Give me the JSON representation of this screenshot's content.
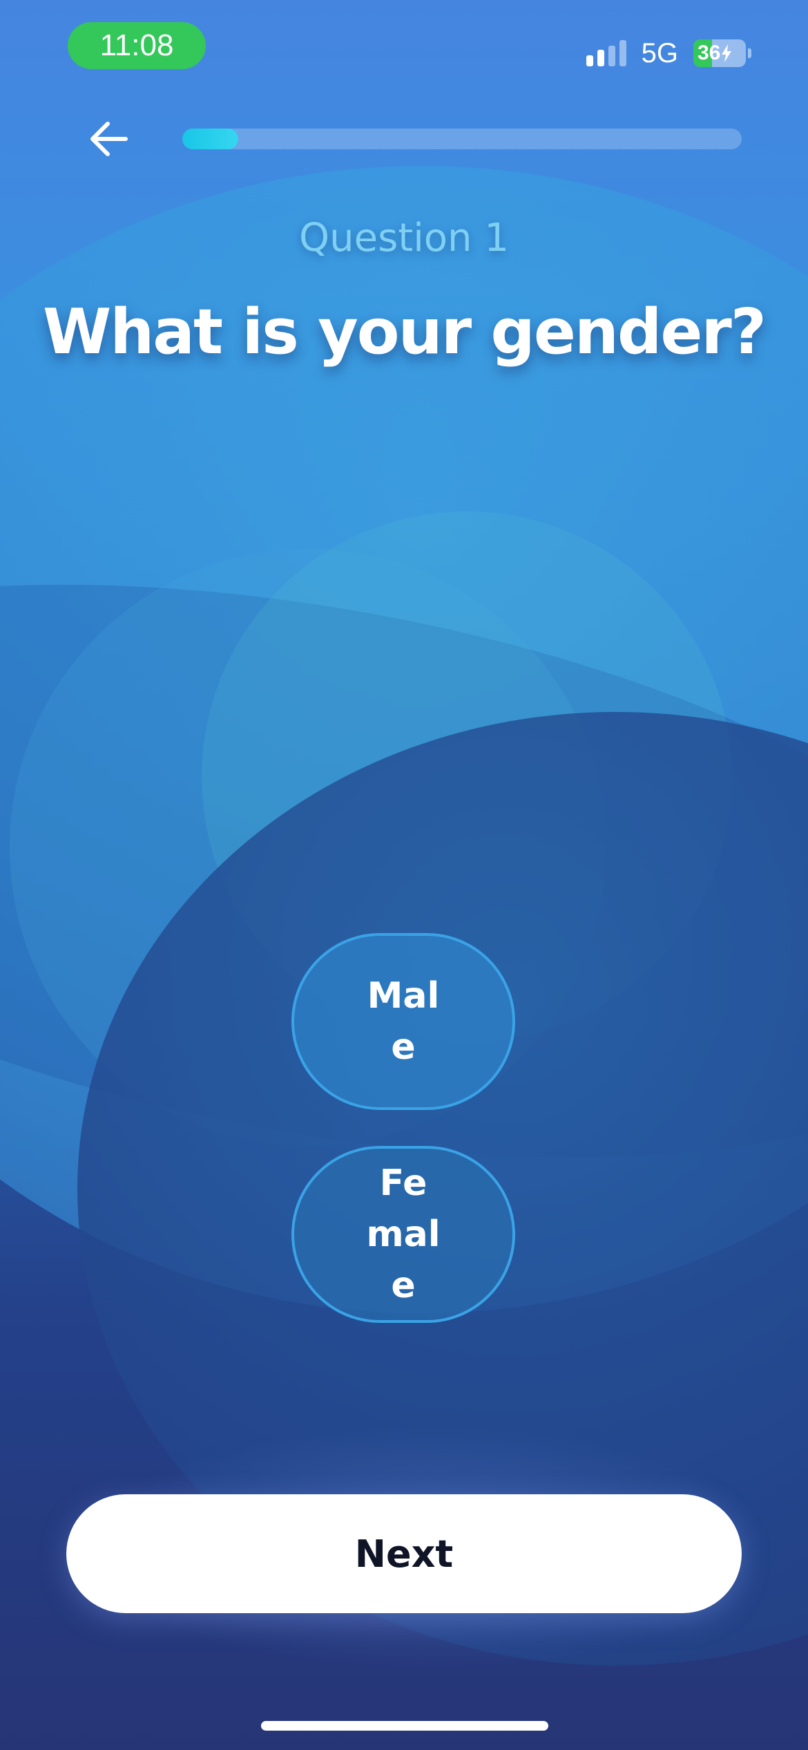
{
  "status_bar": {
    "time": "11:08",
    "network": "5G",
    "battery_percent": "36",
    "signal_bars_active": 2,
    "signal_bars_total": 4,
    "battery_charging": true
  },
  "header": {
    "back_icon": "arrow-left-icon",
    "progress_fraction": 0.1
  },
  "question": {
    "number_label": "Question 1",
    "title": "What is your gender?"
  },
  "options": [
    {
      "label": "Male"
    },
    {
      "label": "Female"
    }
  ],
  "next_button": {
    "label": "Next"
  },
  "colors": {
    "status_time_bg": "#34c759",
    "progress_fill": "#19c6e6",
    "option_border": "#3aa3e6",
    "question_number": "#7fd0f3",
    "next_button_bg": "#ffffff",
    "next_button_text": "#0f1426"
  }
}
